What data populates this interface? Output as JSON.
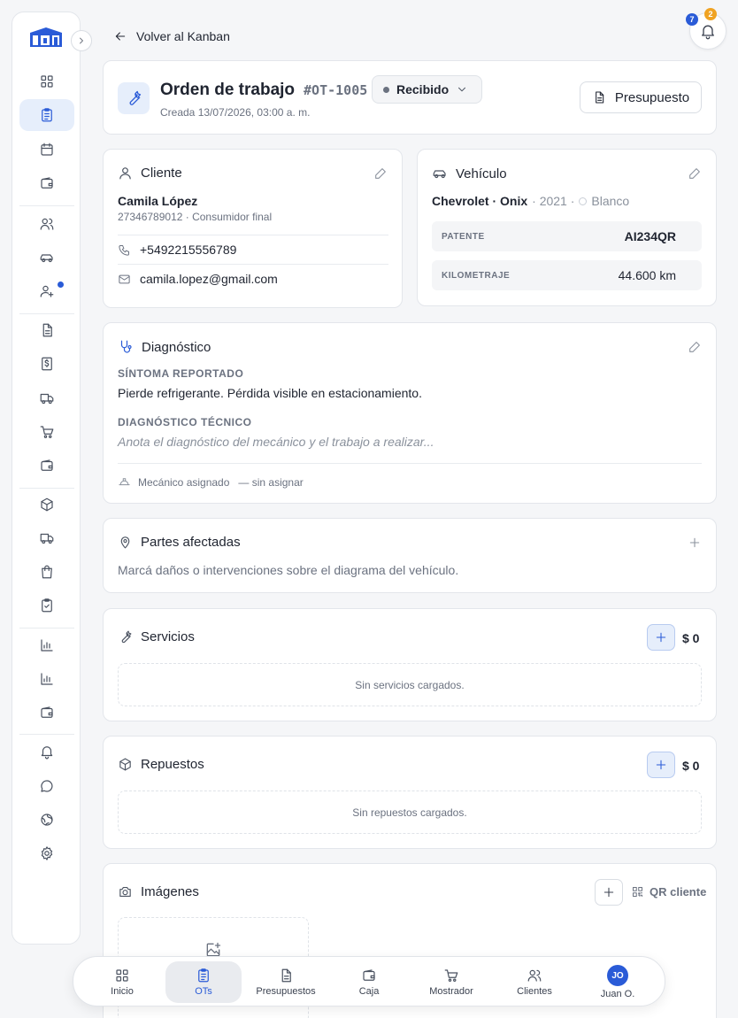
{
  "back_label": "Volver al Kanban",
  "notifications": {
    "blue_count": "7",
    "orange_count": "2"
  },
  "header": {
    "title": "Orden de trabajo",
    "code": "#OT-1005",
    "status": "Recibido",
    "created": "Creada 13/07/2026, 03:00 a. m.",
    "budget_button": "Presupuesto"
  },
  "client": {
    "section_title": "Cliente",
    "name": "Camila López",
    "sub": "27346789012 · Consumidor final",
    "phone": "+5492215556789",
    "email": "camila.lopez@gmail.com"
  },
  "vehicle": {
    "section_title": "Vehículo",
    "make_model": "Chevrolet · Onix",
    "year": "· 2021 ·",
    "color": "Blanco",
    "plate_label": "PATENTE",
    "plate_value": "AI234QR",
    "km_label": "KILOMETRAJE",
    "km_value": "44.600 km"
  },
  "diagnosis": {
    "section_title": "Diagnóstico",
    "symptom_label": "SÍNTOMA REPORTADO",
    "symptom_text": "Pierde refrigerante. Pérdida visible en estacionamiento.",
    "tech_label": "DIAGNÓSTICO TÉCNICO",
    "tech_placeholder": "Anota el diagnóstico del mecánico y el trabajo a realizar...",
    "mechanic_label": "Mecánico asignado",
    "mechanic_value": "— sin asignar"
  },
  "parts": {
    "section_title": "Partes afectadas",
    "hint": "Marcá daños o intervenciones sobre el diagrama del vehículo."
  },
  "services": {
    "section_title": "Servicios",
    "total": "$ 0",
    "empty": "Sin servicios cargados."
  },
  "spares": {
    "section_title": "Repuestos",
    "total": "$ 0",
    "empty": "Sin repuestos cargados."
  },
  "images": {
    "section_title": "Imágenes",
    "qr_label": "QR cliente"
  },
  "bottom_nav": {
    "items": [
      {
        "label": "Inicio",
        "icon": "grid-icon"
      },
      {
        "label": "OTs",
        "icon": "clipboard-icon"
      },
      {
        "label": "Presupuestos",
        "icon": "document-icon"
      },
      {
        "label": "Caja",
        "icon": "wallet-icon"
      },
      {
        "label": "Mostrador",
        "icon": "cart-icon"
      },
      {
        "label": "Clientes",
        "icon": "users-icon"
      },
      {
        "label": "Juan O.",
        "icon": "avatar"
      }
    ],
    "avatar_initials": "JO"
  },
  "colors": {
    "accent": "#2a5bd7",
    "badge_orange": "#f0a323",
    "active_bg": "#e6eefb"
  }
}
